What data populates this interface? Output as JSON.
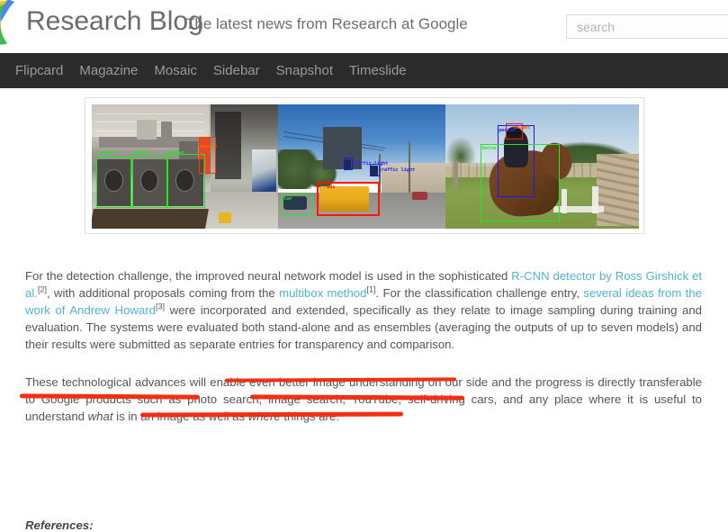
{
  "header": {
    "logo_icon": "blogger-google-colors-logo",
    "title": "Research Blog",
    "description": "The latest news from Research at Google",
    "search": {
      "placeholder": "search",
      "value": ""
    }
  },
  "nav": {
    "items": [
      {
        "label": "Flipcard"
      },
      {
        "label": "Magazine"
      },
      {
        "label": "Mosaic"
      },
      {
        "label": "Sidebar"
      },
      {
        "label": "Snapshot"
      },
      {
        "label": "Timeslide"
      }
    ]
  },
  "figure": {
    "caption": "",
    "images": [
      {
        "name": "laundromat-detection",
        "detections": [
          {
            "label": "washer",
            "color": "#21e721"
          },
          {
            "label": "washer",
            "color": "#21e721"
          },
          {
            "label": "washer",
            "color": "#21e721"
          },
          {
            "label": "person",
            "color": "#ff3b00"
          }
        ]
      },
      {
        "name": "street-bus-detection",
        "detections": [
          {
            "label": "traffic light",
            "color": "#1a1af0"
          },
          {
            "label": "traffic light",
            "color": "#1a1af0"
          },
          {
            "label": "car",
            "color": "#21e721"
          },
          {
            "label": "bus",
            "color": "#ff1500"
          }
        ]
      },
      {
        "name": "horse-rider-detection",
        "detections": [
          {
            "label": "person",
            "color": "#1a1af0"
          },
          {
            "label": "horse",
            "color": "#21e721"
          },
          {
            "label": "helmet",
            "color": "#ff1500"
          }
        ]
      }
    ]
  },
  "article": {
    "paragraph1": {
      "s1": "For the detection challenge, the improved neural network model is used in the sophisticated ",
      "link1": "R-CNN detector by Ross Girshick et al.",
      "sup1": "[2]",
      "s2": ", with additional proposals coming from the ",
      "link2": "multibox method",
      "sup2": "[1]",
      "s3": ". For the classification challenge entry, ",
      "link3": "several ideas from the work of Andrew Howard",
      "sup3": "[3]",
      "s4": " were incorporated and extended, specifically as they relate to image sampling during training and evaluation. The systems were evaluated both stand-alone and as ensembles (averaging the outputs of up to seven models) and their results were submitted as separate entries for transparency and comparison."
    },
    "paragraph2": {
      "s1": "These technological advances will ",
      "hl1": "enable even better image understanding",
      "s2": " on our side and the progress is directly ",
      "hl2": "transferable to Google products",
      "s3": " such as ",
      "hl3": "photo search, image search, YouTube",
      "s4": ", self-driving cars, and any place where it is useful to understand ",
      "em1": "what",
      "s5": " is in an image as well as ",
      "em2": "where",
      "s6": " things are."
    },
    "references_heading": "References:"
  },
  "colors": {
    "link": "#4fb4d2",
    "nav_bg": "#2b2b2b",
    "annotation_red": "#f22f12",
    "body_text": "#555555"
  }
}
